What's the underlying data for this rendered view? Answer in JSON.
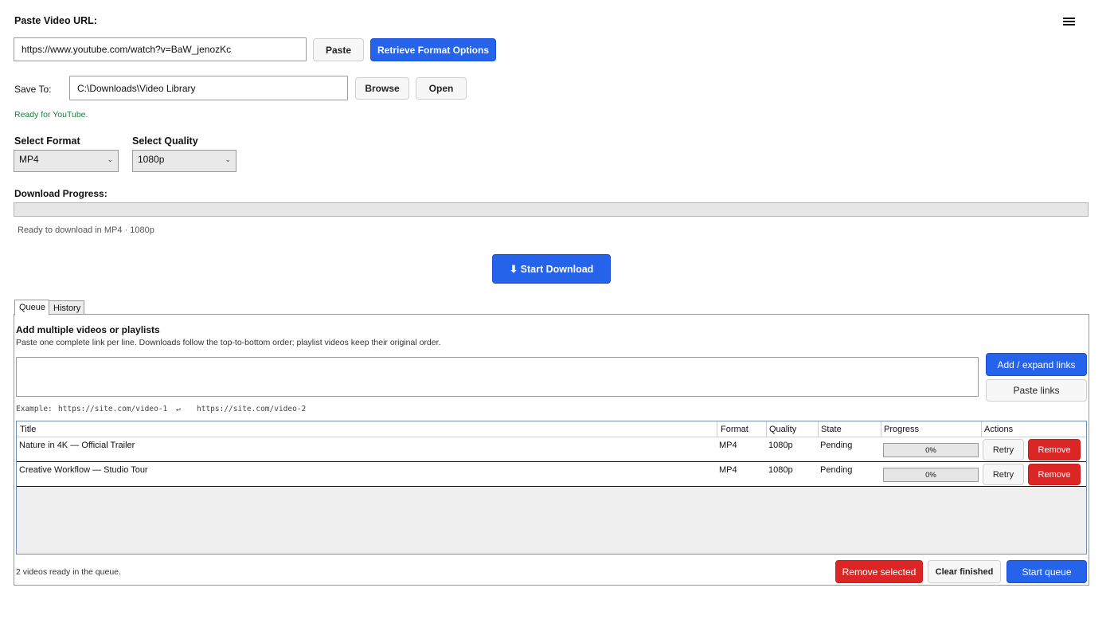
{
  "url_section": {
    "label": "Paste Video URL:",
    "url_value": "https://www.youtube.com/watch?v=BaW_jenozKc",
    "paste_label": "Paste",
    "retrieve_label": "Retrieve Format Options"
  },
  "menu_icon": "hamburger-menu-icon",
  "save_section": {
    "label": "Save To:",
    "path_value": "C:\\Downloads\\Video Library",
    "browse_label": "Browse",
    "open_label": "Open",
    "status": "Ready for YouTube."
  },
  "format": {
    "format_label": "Select Format",
    "format_value": "MP4",
    "quality_label": "Select Quality",
    "quality_value": "1080p"
  },
  "progress": {
    "label": "Download Progress:",
    "value": 0,
    "status": "Ready to download in MP4 · 1080p"
  },
  "start_download_label": "⬇ Start Download",
  "tabs": [
    {
      "label": "Queue",
      "active": true
    },
    {
      "label": "History",
      "active": false
    }
  ],
  "queue": {
    "heading": "Add multiple videos or playlists",
    "hint": "Paste one complete link per line. Downloads follow the top-to-bottom order; playlist videos keep their original order.",
    "links_value": "",
    "add_label": "Add / expand links",
    "paste_links_label": "Paste links",
    "example_prefix": "Example:",
    "example_link_1": "https://site.com/video-1",
    "example_arrow": "↵",
    "example_link_2": "https://site.com/video-2",
    "columns": [
      "Title",
      "Format",
      "Quality",
      "State",
      "Progress",
      "Actions"
    ],
    "rows": [
      {
        "title": "Nature in 4K — Official Trailer",
        "format": "MP4",
        "quality": "1080p",
        "state": "Pending",
        "progress": "0%",
        "retry": "Retry",
        "remove": "Remove"
      },
      {
        "title": "Creative Workflow — Studio Tour",
        "format": "MP4",
        "quality": "1080p",
        "state": "Pending",
        "progress": "0%",
        "retry": "Retry",
        "remove": "Remove"
      }
    ],
    "footer_status": "2 videos ready in the queue.",
    "remove_selected_label": "Remove selected",
    "clear_finished_label": "Clear finished",
    "start_queue_label": "Start queue"
  },
  "colors": {
    "accent": "#2563eb",
    "danger": "#dc2626",
    "status_green": "#1a7f37"
  }
}
